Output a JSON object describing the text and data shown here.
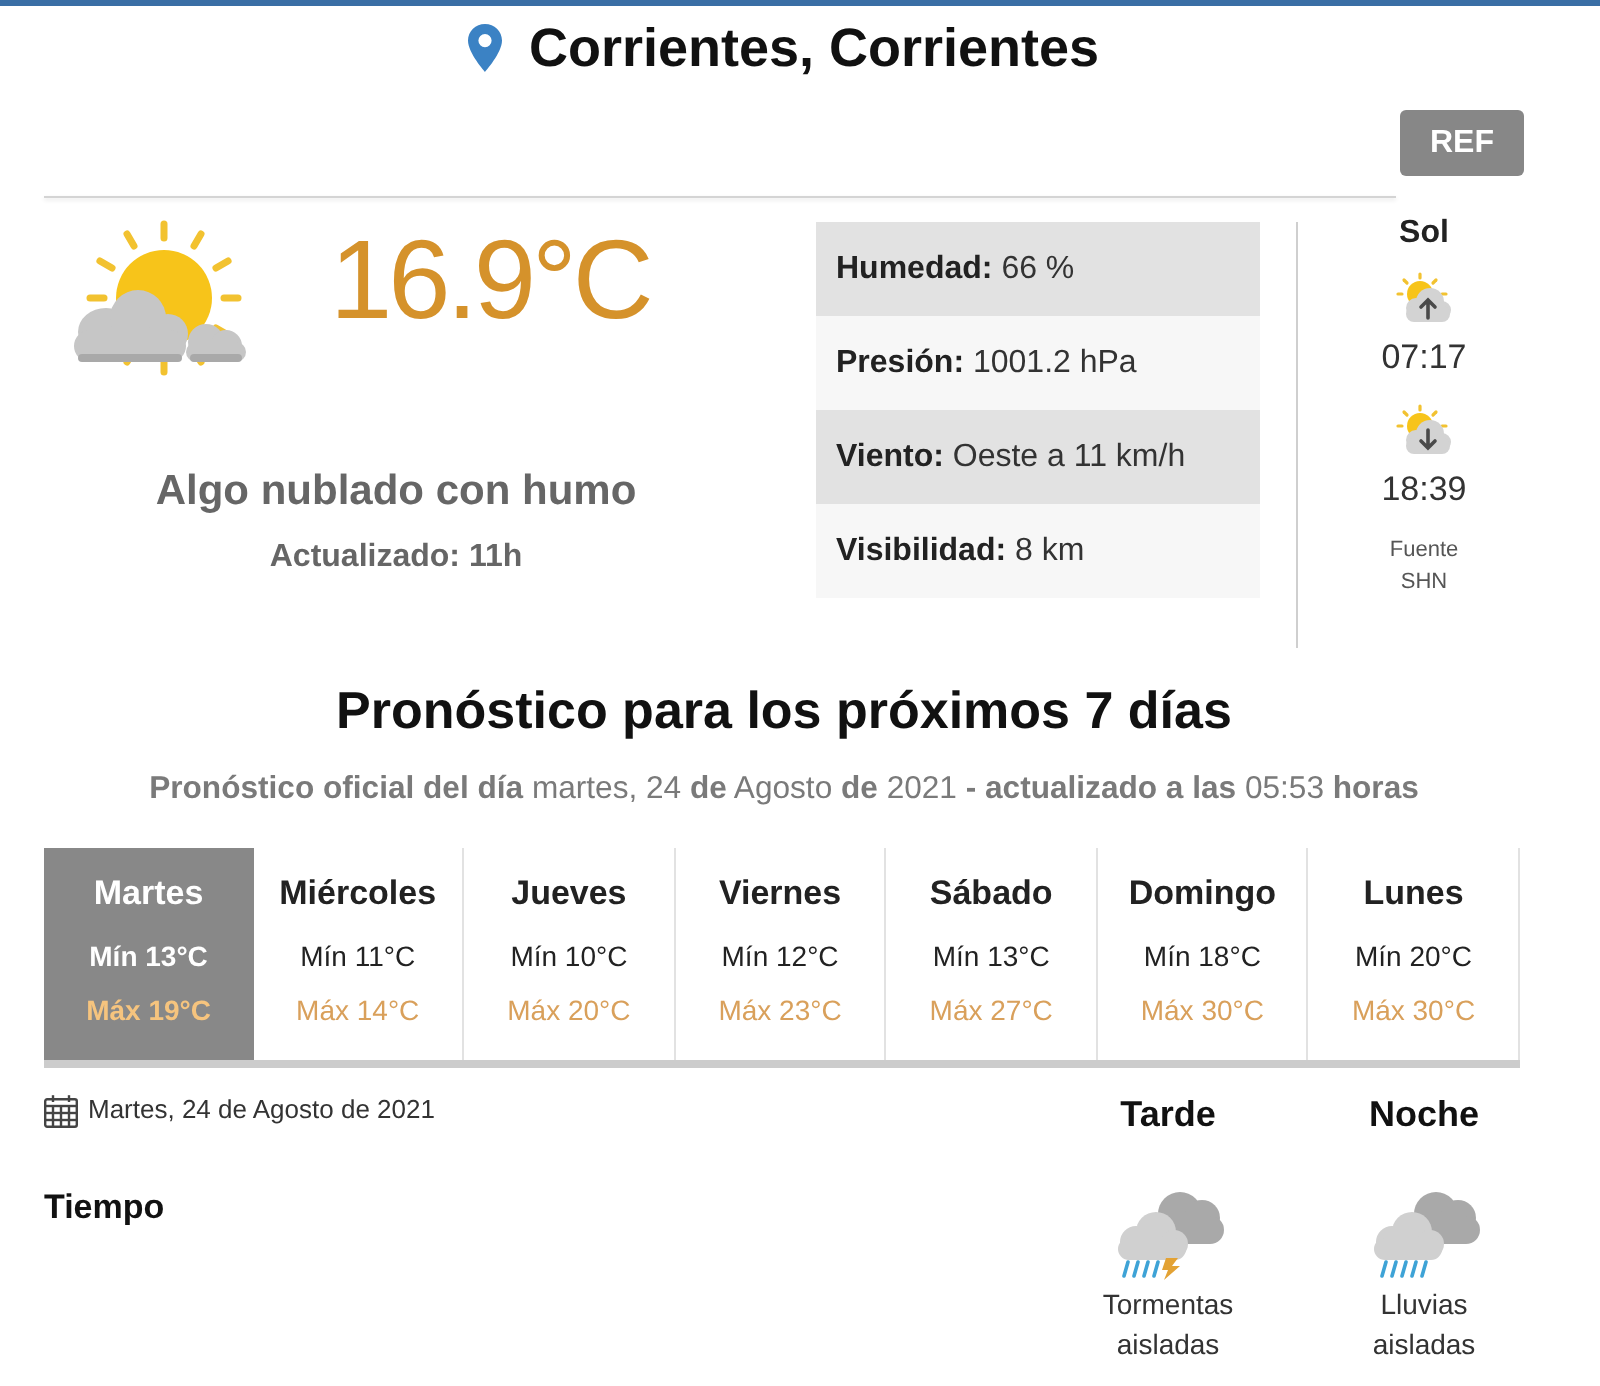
{
  "location": {
    "title": "Corrientes, Corrientes"
  },
  "refresh_button": {
    "label": "REF"
  },
  "current": {
    "temperature": "16.9°C",
    "condition": "Algo nublado con humo",
    "updated": "Actualizado: 11h"
  },
  "details": [
    {
      "label": "Humedad:",
      "value": "66 %"
    },
    {
      "label": "Presión:",
      "value": "1001.2 hPa"
    },
    {
      "label": "Viento:",
      "value": "Oeste a 11 km/h"
    },
    {
      "label": "Visibilidad:",
      "value": "8 km"
    }
  ],
  "sun": {
    "title": "Sol",
    "sunrise": "07:17",
    "sunset": "18:39",
    "source_label": "Fuente",
    "source_name": "SHN"
  },
  "forecast": {
    "title": "Pronóstico para los próximos 7 días",
    "subtitle": "**Pronóstico oficial del día** martes, 24 **de** Agosto **de** 2021 **- actualizado a las** 05:53 **horas**",
    "days": [
      {
        "name": "Martes",
        "min": "Mín 13°C",
        "max": "Máx 19°C",
        "selected": true
      },
      {
        "name": "Miércoles",
        "min": "Mín 11°C",
        "max": "Máx 14°C",
        "selected": false
      },
      {
        "name": "Jueves",
        "min": "Mín 10°C",
        "max": "Máx 20°C",
        "selected": false
      },
      {
        "name": "Viernes",
        "min": "Mín 12°C",
        "max": "Máx 23°C",
        "selected": false
      },
      {
        "name": "Sábado",
        "min": "Mín 13°C",
        "max": "Máx 27°C",
        "selected": false
      },
      {
        "name": "Domingo",
        "min": "Mín 18°C",
        "max": "Máx 30°C",
        "selected": false
      },
      {
        "name": "Lunes",
        "min": "Mín 20°C",
        "max": "Máx 30°C",
        "selected": false
      }
    ]
  },
  "day_detail": {
    "date": "Martes, 24 de Agosto de 2021",
    "row_label": "Tiempo",
    "periods": [
      {
        "name": "Tarde",
        "kind": "storm",
        "description": "Tormentas aisladas"
      },
      {
        "name": "Noche",
        "kind": "rain",
        "description": "Lluvias aisladas"
      }
    ]
  }
}
